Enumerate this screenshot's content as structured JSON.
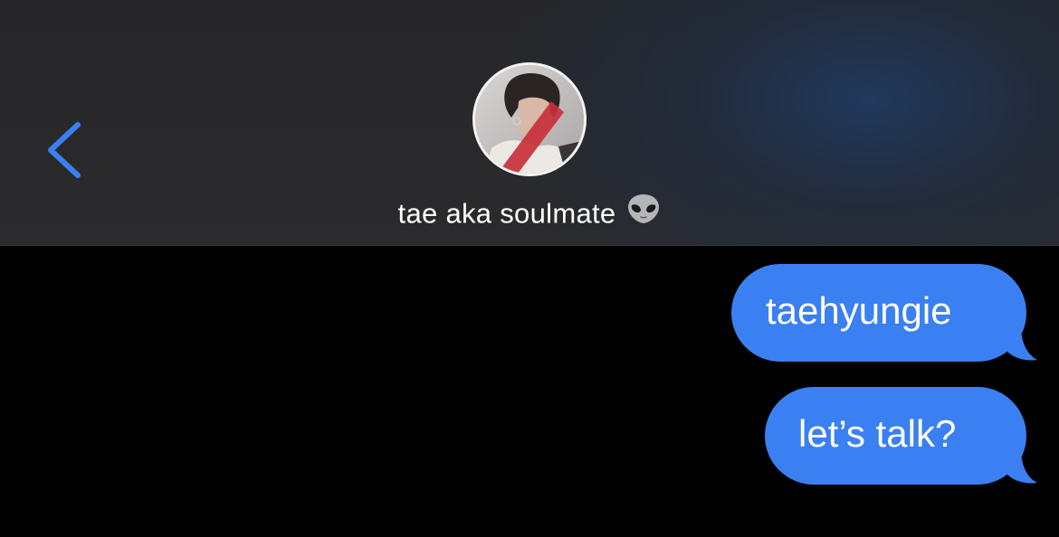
{
  "header": {
    "back_icon": "chevron-left-icon",
    "contact_name": "tae aka soulmate",
    "contact_emoji": "alien-emoji",
    "accent_color": "#3a80f2"
  },
  "messages": [
    {
      "direction": "outgoing",
      "text": "taehyungie"
    },
    {
      "direction": "outgoing",
      "text": "let’s talk?"
    }
  ],
  "colors": {
    "bubble_outgoing": "#3a80f2",
    "background": "#000000",
    "header": "#2a2a2c"
  }
}
